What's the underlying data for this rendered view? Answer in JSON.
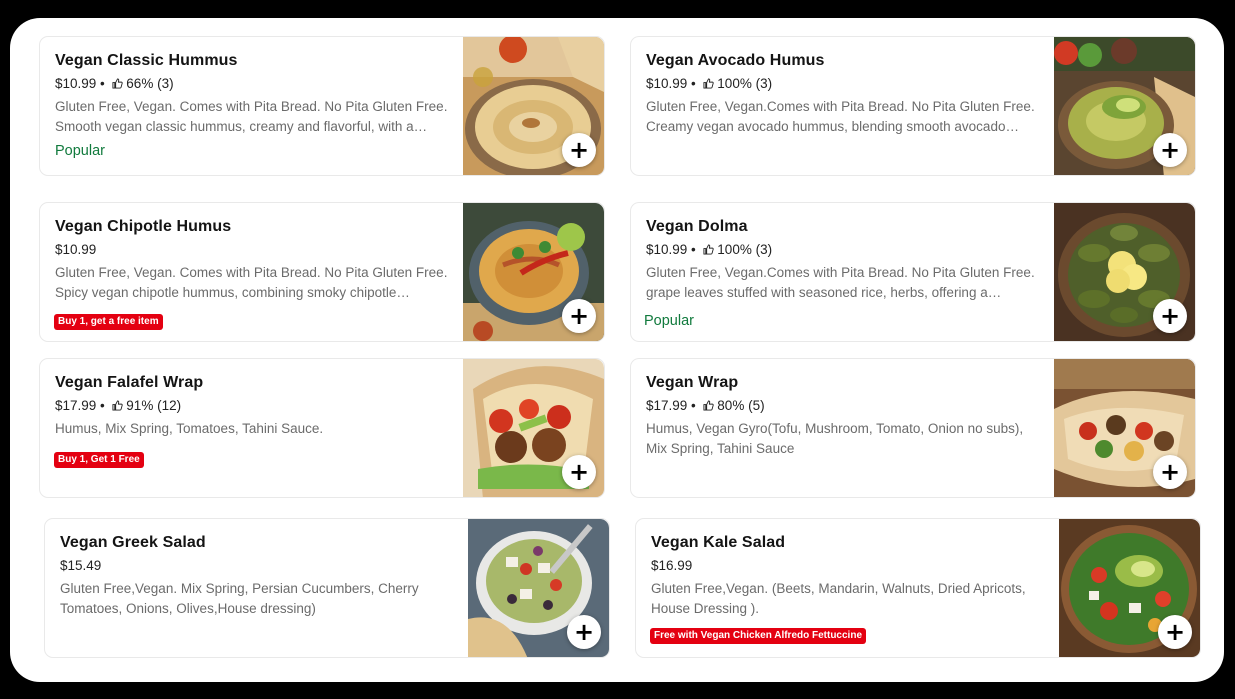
{
  "menu": {
    "items": [
      {
        "name": "Vegan Classic Hummus",
        "price": "$10.99",
        "rating": "66% (3)",
        "description": "Gluten Free, Vegan. Comes with Pita Bread. No Pita Gluten Free. Smooth vegan classic hummus, creamy and flavorful, with a…",
        "badge": "Popular",
        "promo": ""
      },
      {
        "name": "Vegan Avocado Humus",
        "price": "$10.99",
        "rating": "100% (3)",
        "description": "Gluten Free, Vegan.Comes with Pita Bread. No Pita Gluten Free. Creamy vegan avocado hummus, blending smooth avocado…",
        "badge": "",
        "promo": ""
      },
      {
        "name": "Vegan Chipotle Humus",
        "price": "$10.99",
        "rating": "",
        "description": "Gluten Free, Vegan. Comes with Pita Bread. No Pita Gluten Free. Spicy vegan chipotle hummus, combining smoky chipotle…",
        "badge": "",
        "promo": "Buy 1, get a free item"
      },
      {
        "name": "Vegan Dolma",
        "price": "$10.99",
        "rating": "100% (3)",
        "description": "Gluten Free, Vegan.Comes with Pita Bread. No Pita Gluten Free. grape leaves stuffed with seasoned rice, herbs, offering a…",
        "badge": "Popular",
        "promo": ""
      },
      {
        "name": "Vegan Falafel Wrap",
        "price": "$17.99",
        "rating": "91% (12)",
        "description": "Humus, Mix Spring, Tomatoes, Tahini Sauce.",
        "badge": "",
        "promo": "Buy 1, Get 1 Free"
      },
      {
        "name": "Vegan Wrap",
        "price": "$17.99",
        "rating": "80% (5)",
        "description": "Humus, Vegan Gyro(Tofu, Mushroom, Tomato, Onion no subs), Mix Spring, Tahini Sauce",
        "badge": "",
        "promo": ""
      },
      {
        "name": "Vegan Greek Salad",
        "price": "$15.49",
        "rating": "",
        "description": "Gluten Free,Vegan. Mix Spring, Persian Cucumbers, Cherry Tomatoes, Onions, Olives,House dressing)",
        "badge": "",
        "promo": ""
      },
      {
        "name": "Vegan Kale Salad",
        "price": "$16.99",
        "rating": "",
        "description": "Gluten Free,Vegan. (Beets, Mandarin, Walnuts, Dried Apricots, House Dressing ).",
        "badge": "",
        "promo": "Free with Vegan Chicken Alfredo Fettuccine"
      }
    ]
  },
  "colors": {
    "popular": "#117a3d",
    "promo": "#e40011"
  },
  "icons": {
    "rating": "thumbs-up-icon",
    "add": "plus-icon"
  }
}
